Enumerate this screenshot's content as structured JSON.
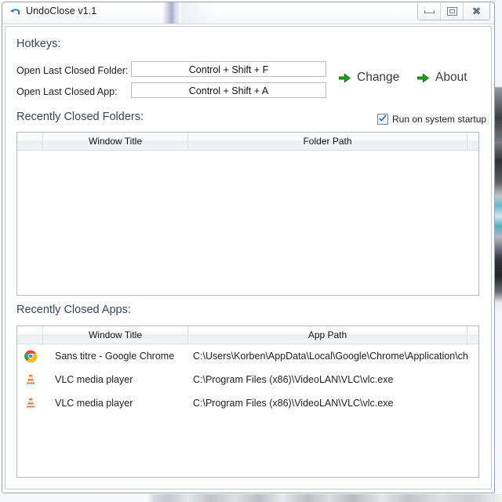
{
  "window": {
    "title": "UndoClose v1.1",
    "icon": "undo-arrow-icon",
    "buttons": {
      "minimize": "minimize-button",
      "restore": "restore-button",
      "close": "close-button"
    }
  },
  "hotkeys": {
    "section_title": "Hotkeys:",
    "rows": [
      {
        "label": "Open Last Closed Folder:",
        "value": "Control + Shift + F"
      },
      {
        "label": "Open Last Closed App:",
        "value": "Control + Shift + A"
      }
    ],
    "actions": [
      {
        "label": "Change",
        "icon": "green-arrow-icon"
      },
      {
        "label": "About",
        "icon": "green-arrow-icon"
      }
    ]
  },
  "startup": {
    "label": "Run on system startup",
    "checked": true
  },
  "folders_section": {
    "title": "Recently Closed Folders:",
    "columns": [
      "",
      "Window Title",
      "Folder Path",
      ""
    ],
    "rows": []
  },
  "apps_section": {
    "title": "Recently Closed Apps:",
    "columns": [
      "",
      "Window Title",
      "App Path",
      ""
    ],
    "rows": [
      {
        "icon": "chrome-icon",
        "title": "Sans titre - Google Chrome",
        "path": "C:\\Users\\Korben\\AppData\\Local\\Google\\Chrome\\Application\\ch"
      },
      {
        "icon": "vlc-icon",
        "title": "VLC media player",
        "path": "C:\\Program Files (x86)\\VideoLAN\\VLC\\vlc.exe"
      },
      {
        "icon": "vlc-icon",
        "title": "VLC media player",
        "path": "C:\\Program Files (x86)\\VideoLAN\\VLC\\vlc.exe"
      }
    ]
  },
  "colors": {
    "section_heading": "#33475b",
    "arrow_green": "#1faa1f",
    "checkbox_check": "#2a6fc9",
    "window_border": "#9aa0a8"
  }
}
